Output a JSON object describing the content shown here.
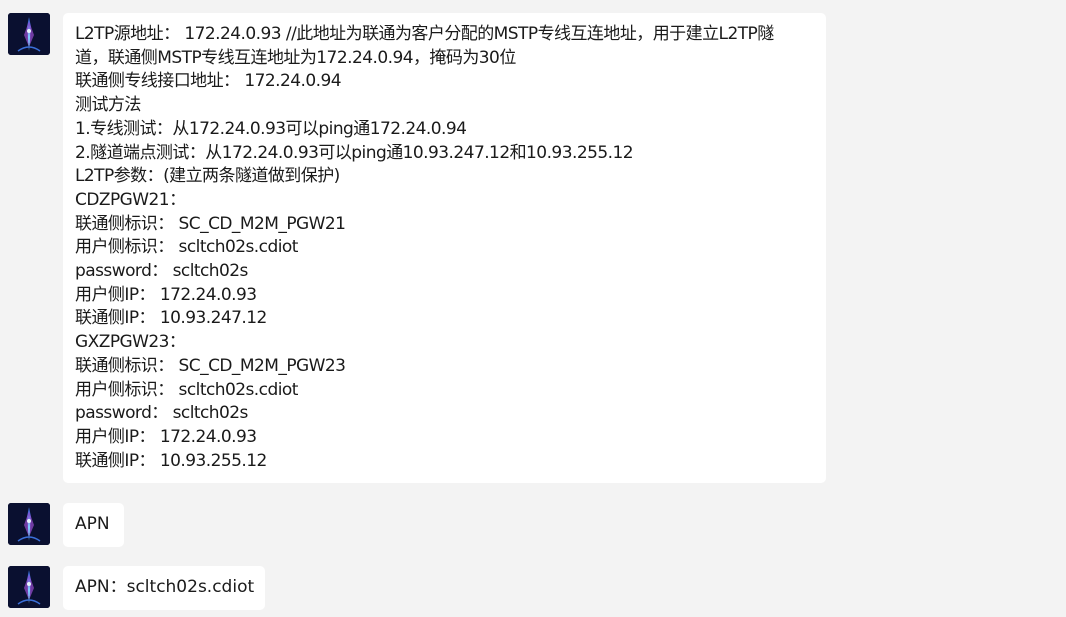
{
  "messages": [
    {
      "id": "msg-1",
      "lines": [
        "L2TP源地址： 172.24.0.93 //此地址为联通为客户分配的MSTP专线互连地址，用于建立L2TP隧",
        "道，联通侧MSTP专线互连地址为172.24.0.94，掩码为30位",
        "联通侧专线接口地址： 172.24.0.94",
        "测试方法",
        "1.专线测试：从172.24.0.93可以ping通172.24.0.94",
        "2.隧道端点测试：从172.24.0.93可以ping通10.93.247.12和10.93.255.12",
        "L2TP参数：(建立两条隧道做到保护)",
        "CDZPGW21：",
        "联通侧标识： SC_CD_M2M_PGW21",
        "用户侧标识： scltch02s.cdiot",
        "password： scltch02s",
        "用户侧IP： 172.24.0.93",
        "联通侧IP： 10.93.247.12",
        "GXZPGW23：",
        "联通侧标识： SC_CD_M2M_PGW23",
        "用户侧标识： scltch02s.cdiot",
        "password： scltch02s",
        "用户侧IP： 172.24.0.93",
        "联通侧IP： 10.93.255.12"
      ]
    },
    {
      "id": "msg-2",
      "lines": [
        "APN"
      ]
    },
    {
      "id": "msg-3",
      "lines": [
        "APN：scltch02s.cdiot"
      ]
    }
  ],
  "avatar": {
    "icon": "avatar-image-icon",
    "bg_color": "#0a1030",
    "accent_colors": [
      "#3a6fd8",
      "#9a4fd0",
      "#7fd0ff"
    ]
  },
  "colors": {
    "background": "#f3f3f3",
    "bubble": "#ffffff",
    "text": "#1a1a1a"
  }
}
